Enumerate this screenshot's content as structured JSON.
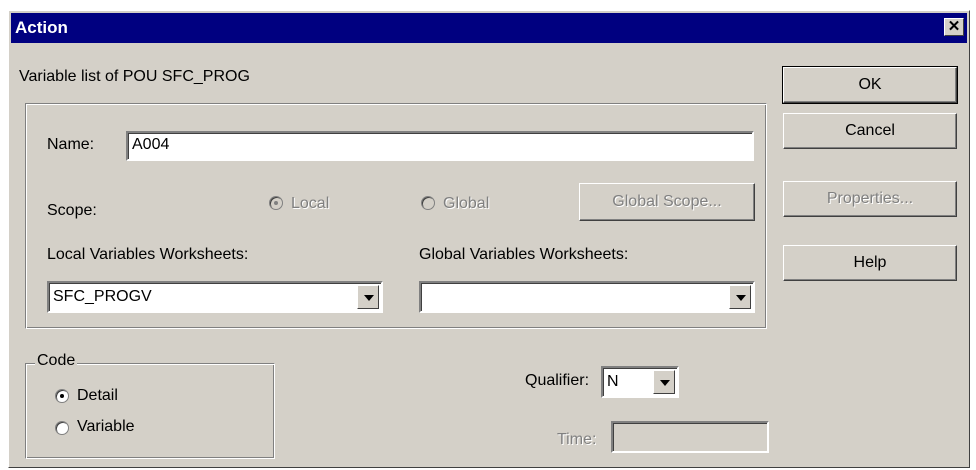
{
  "window": {
    "title": "Action",
    "close_glyph": "✕"
  },
  "header": {
    "variable_list_label": "Variable list of POU SFC_PROG"
  },
  "name": {
    "label": "Name:",
    "value": "A004"
  },
  "scope": {
    "label": "Scope:",
    "local_label": "Local",
    "global_label": "Global",
    "global_scope_button": "Global Scope...",
    "selected": "Local"
  },
  "worksheets": {
    "local_label": "Local Variables Worksheets:",
    "local_value": "SFC_PROGV",
    "global_label": "Global Variables Worksheets:",
    "global_value": ""
  },
  "code": {
    "group_label": "Code",
    "detail_label": "Detail",
    "variable_label": "Variable",
    "selected": "Detail"
  },
  "qualifier": {
    "label": "Qualifier:",
    "value": "N"
  },
  "time": {
    "label": "Time:",
    "value": ""
  },
  "buttons": {
    "ok": "OK",
    "cancel": "Cancel",
    "properties": "Properties...",
    "help": "Help"
  }
}
